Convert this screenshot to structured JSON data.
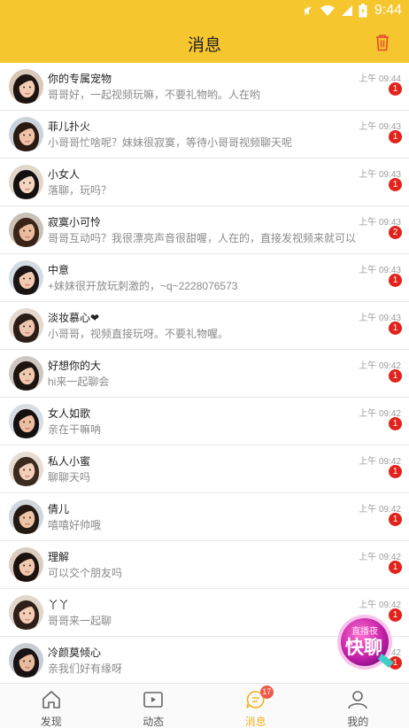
{
  "status_bar": {
    "time": "9:44"
  },
  "header": {
    "title": "消息"
  },
  "conversations": [
    {
      "name": "你的专属宠物",
      "message": "哥哥好，一起视频玩嘛，不要礼物哟。人在哟",
      "time": "上午 09:44",
      "badge": "1"
    },
    {
      "name": "菲儿扑火",
      "message": "小哥哥忙啥呢？妹妹很寂寞，等待小哥哥视频聊天呢",
      "time": "上午 09:43",
      "badge": "1"
    },
    {
      "name": "小女人",
      "message": "落聊，玩吗？",
      "time": "上午 09:43",
      "badge": "1"
    },
    {
      "name": "寂寞小可怜",
      "message": "哥哥互动吗？我很漂亮声音很甜喔，人在的，直接发视频来就可以了",
      "time": "上午 09:43",
      "badge": "2"
    },
    {
      "name": "中意",
      "message": "+妹妹很开放玩刺激的，~q~2228076573",
      "time": "上午 09:43",
      "badge": "1"
    },
    {
      "name": "淡妆慕心❤",
      "message": "小哥哥，视频直接玩呀。不要礼物喔。",
      "time": "上午 09:43",
      "badge": "1"
    },
    {
      "name": "好想你的大",
      "message": "hi来一起聊会",
      "time": "上午 09:42",
      "badge": "1"
    },
    {
      "name": "女人如歌",
      "message": "亲在干嘛呐",
      "time": "上午 09:42",
      "badge": "1"
    },
    {
      "name": "私人小蜜",
      "message": "聊聊天吗",
      "time": "上午 09:42",
      "badge": "1"
    },
    {
      "name": "倩儿",
      "message": "嘻嘻好帅哦",
      "time": "上午 09:42",
      "badge": "1"
    },
    {
      "name": "理解",
      "message": "可以交个朋友吗",
      "time": "上午 09:42",
      "badge": "1"
    },
    {
      "name": "丫丫",
      "message": "哥哥来一起聊",
      "time": "上午 09:42",
      "badge": "1"
    },
    {
      "name": "冷颜莫倾心",
      "message": "亲我们好有缘呀",
      "time": "上午 09:42",
      "badge": "1"
    }
  ],
  "promo": {
    "small": "直播夜",
    "big": "快聊"
  },
  "tabbar": {
    "tabs": [
      {
        "label": "发现",
        "icon": "home-icon"
      },
      {
        "label": "动态",
        "icon": "video-icon"
      },
      {
        "label": "消息",
        "icon": "chat-icon",
        "badge": "17"
      },
      {
        "label": "我的",
        "icon": "profile-icon"
      }
    ]
  },
  "colors": {
    "accent": "#f6c62f",
    "badge": "#e1231c",
    "active_tab": "#f0b423"
  },
  "icons": [
    "mute-icon",
    "wifi-icon",
    "signal-icon",
    "battery-icon",
    "trash-icon"
  ]
}
